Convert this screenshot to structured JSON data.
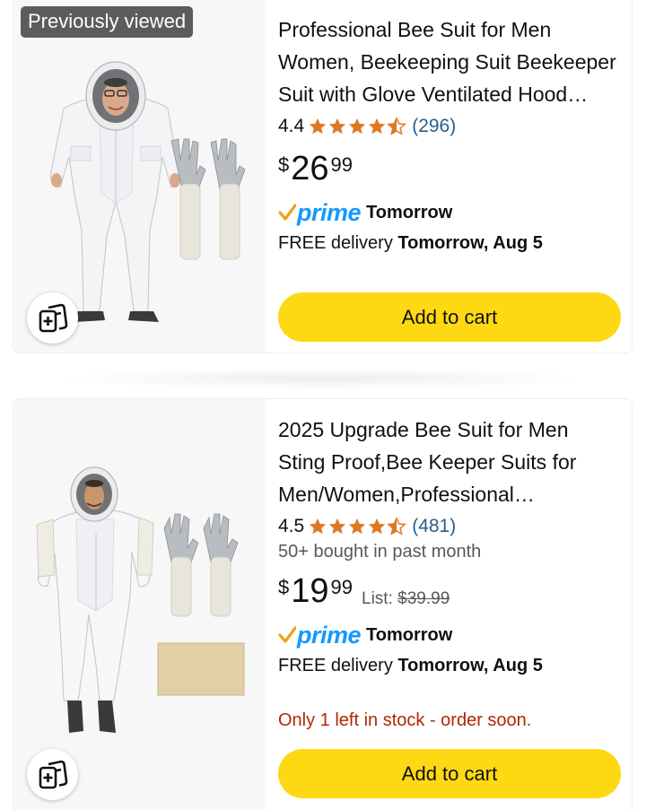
{
  "products": [
    {
      "badge": "Previously viewed",
      "title": "Professional Bee Suit for Men Women, Beekeeping Suit Beekeeper Suit with Glove Ventilated Hood Beekeeper Outfit",
      "rating": "4.4",
      "rating_value": 4.4,
      "review_count": "(296)",
      "price_currency": "$",
      "price_whole": "26",
      "price_fraction": "99",
      "prime_label": "prime",
      "prime_delivery": "Tomorrow",
      "delivery_prefix": "FREE delivery",
      "delivery_date": "Tomorrow, Aug 5",
      "add_to_cart": "Add to cart"
    },
    {
      "title": "2025 Upgrade Bee Suit for Men Sting Proof,Bee Keeper Suits for Men/Women,Professional Beekeeping Suit with Gloves",
      "rating": "4.5",
      "rating_value": 4.5,
      "review_count": "(481)",
      "bought": "50+ bought in past month",
      "price_currency": "$",
      "price_whole": "19",
      "price_fraction": "99",
      "list_label": "List:",
      "list_price": "$39.99",
      "prime_label": "prime",
      "prime_delivery": "Tomorrow",
      "delivery_prefix": "FREE delivery",
      "delivery_date": "Tomorrow, Aug 5",
      "stock": "Only 1 left in stock - order soon.",
      "add_to_cart": "Add to cart"
    }
  ],
  "colors": {
    "star": "#de7921",
    "prime_blue": "#1399ff",
    "prime_check": "#f0a017",
    "cart_button": "#ffd814",
    "stock_red": "#b12704",
    "review_link": "#2a5d8a"
  },
  "icons": [
    "star-icon",
    "half-star-icon",
    "prime-check-icon",
    "compare-icon"
  ]
}
